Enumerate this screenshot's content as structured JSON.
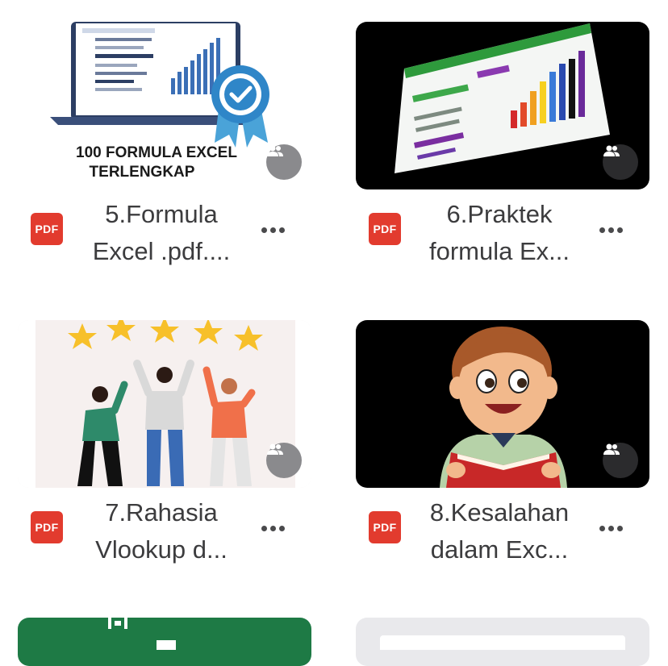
{
  "files": [
    {
      "name_line1": "5.Formula",
      "name_line2": "Excel .pdf....",
      "thumb_title_1": "100 FORMULA EXCEL",
      "thumb_title_2": "TERLENGKAP",
      "type_label": "PDF"
    },
    {
      "name_line1": "6.Praktek",
      "name_line2": "formula Ex...",
      "type_label": "PDF"
    },
    {
      "name_line1": "7.Rahasia",
      "name_line2": "Vlookup d...",
      "type_label": "PDF"
    },
    {
      "name_line1": "8.Kesalahan",
      "name_line2": "dalam Exc...",
      "type_label": "PDF"
    }
  ],
  "icons": {
    "shared": "people-icon",
    "more": "more-horizontal-icon",
    "file_type": "pdf-icon"
  },
  "colors": {
    "pdf_red": "#e23b2e",
    "text": "#3c3c3e",
    "excel_green": "#1e7a45"
  }
}
